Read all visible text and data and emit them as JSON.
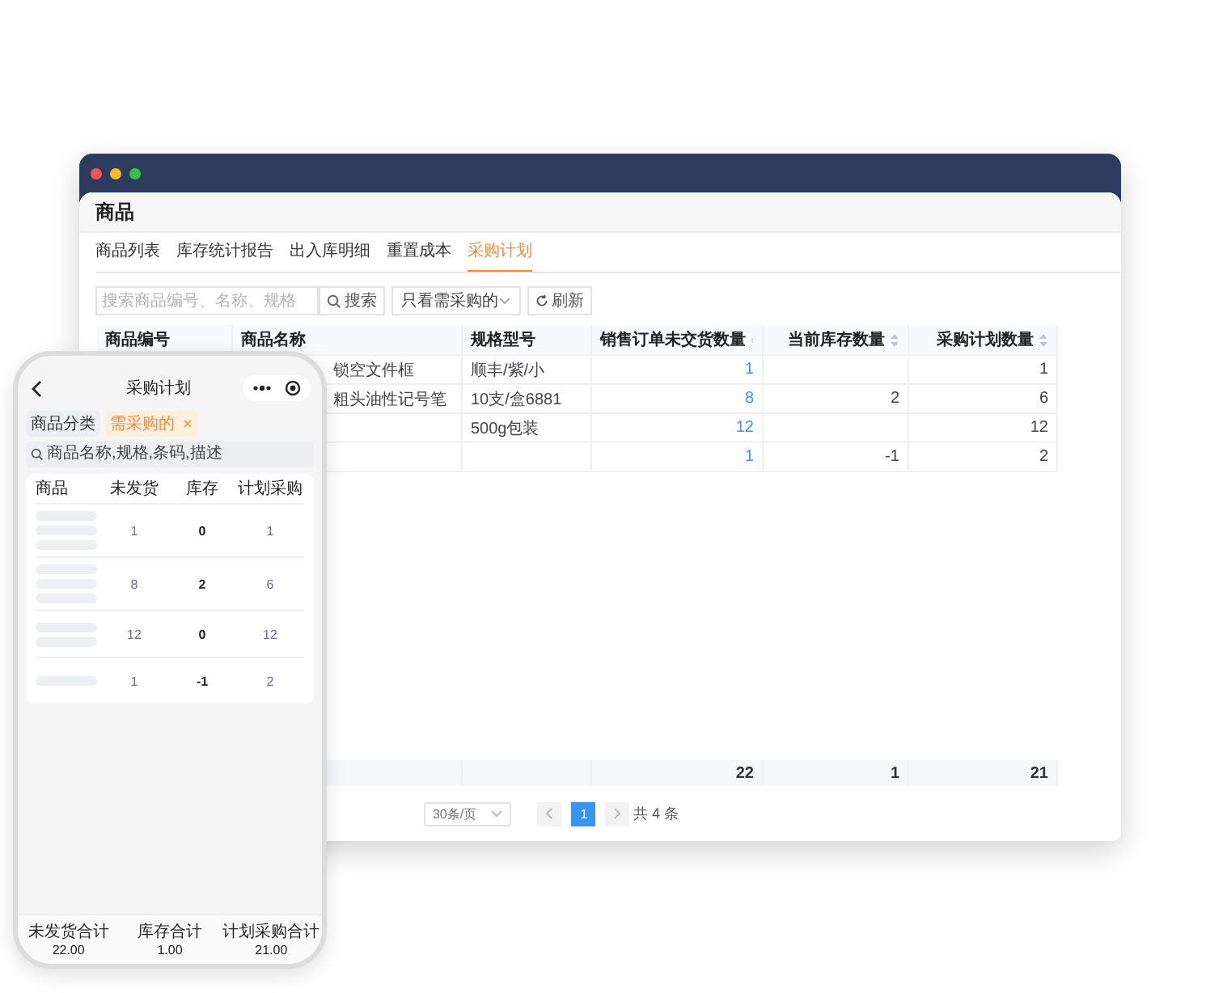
{
  "desktop": {
    "title": "商品",
    "tabs": [
      {
        "label": "商品列表",
        "selected": false
      },
      {
        "label": "库存统计报告",
        "selected": false
      },
      {
        "label": "出入库明细",
        "selected": false
      },
      {
        "label": "重置成本",
        "selected": false
      },
      {
        "label": "采购计划",
        "selected": true
      }
    ],
    "search": {
      "placeholder": "搜索商品编号、名称、规格"
    },
    "search_button": "搜索",
    "filter": {
      "value": "只看需采购的"
    },
    "refresh_button": "刷新",
    "table": {
      "columns": [
        "商品编号",
        "商品名称",
        "规格型号",
        "销售订单未交货数量",
        "当前库存数量",
        "采购计划数量"
      ],
      "rows": [
        {
          "name": "锁空文件框",
          "spec": "顺丰/紫/小",
          "unshipped": "1",
          "plan": "1"
        },
        {
          "name": "粗头油性记号笔",
          "spec": "10支/盒6881",
          "unshipped": "8",
          "stock": "2",
          "plan": "6"
        },
        {
          "spec": "500g包装",
          "unshipped": "12",
          "plan": "12"
        },
        {
          "unshipped": "1",
          "stock": "-1",
          "plan": "2"
        }
      ],
      "totals": {
        "unshipped": "22",
        "stock": "1",
        "plan": "21"
      }
    },
    "pagination": {
      "page_size": "30条/页",
      "pages": [
        {
          "label": "1",
          "selected": true
        }
      ],
      "total": "共 4 条"
    }
  },
  "phone": {
    "title": "采购计划",
    "chips": [
      {
        "label": "商品分类",
        "selected": false
      },
      {
        "label": "需采购的",
        "selected": true
      }
    ],
    "search": {
      "placeholder": "商品名称,规格,条码,描述"
    },
    "columns": [
      "商品",
      "未发货",
      "库存",
      "计划采购"
    ],
    "rows": [
      {
        "unshipped": "1",
        "stock": "0",
        "plan": "1"
      },
      {
        "unshipped": "8",
        "stock": "2",
        "plan": "6"
      },
      {
        "unshipped": "12",
        "stock": "0",
        "plan": "12"
      },
      {
        "unshipped": "1",
        "stock": "-1",
        "plan": "2"
      }
    ],
    "totals": [
      {
        "label": "未发货合计",
        "value": "22.00"
      },
      {
        "label": "库存合计",
        "value": "1.00"
      },
      {
        "label": "计划采购合计",
        "value": "21.00"
      }
    ]
  }
}
